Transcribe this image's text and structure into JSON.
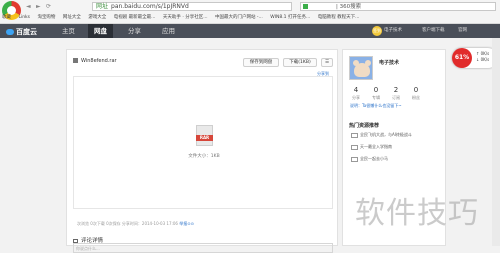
{
  "browser": {
    "url_prefix": "网址",
    "url": "pan.baidu.com/s/1pJRNVd",
    "search_text": "| 360搜索",
    "nav_back": "◄",
    "nav_forward": "►",
    "nav_refresh": "⟳",
    "bookmarks": [
      "收藏",
      "Links",
      "淘宝购物",
      "网址大全",
      "游戏大全",
      "电视剧 最新最全最...",
      "天天助手 · 分享社区...",
      "中国最大的门户网站 -...",
      "WIN8.1 打开任务...",
      "电脑教程 教程天下..."
    ]
  },
  "header": {
    "logo": "百度云",
    "tabs": [
      "主页",
      "网盘",
      "分享",
      "应用"
    ],
    "active_tab": "网盘",
    "user_name": "电子技术",
    "links": [
      "客户端下载",
      "官网"
    ],
    "sign_badge": "签到"
  },
  "speed_widget": {
    "percent": "61%",
    "line1": "↑ 0K/s",
    "line2": "↓ 0K/s"
  },
  "file": {
    "name": "Win8efend.rar",
    "save_label": "保存到网盘",
    "download_label": "下载(1KB)",
    "report_label": "举报",
    "share_line": "分享到",
    "type_label": "RAR",
    "size_text": "文件大小：1KB",
    "meta": "次浏览   0次下载   0次保存   分享时间：2014-10-03 17:06",
    "meta_link": "举报⊙⊙",
    "comment_title": "评论详情",
    "comment_placeholder": "你说点什么..."
  },
  "sidebar": {
    "user_name": "电子技术",
    "stats": [
      {
        "n": "4",
        "l": "分享"
      },
      {
        "n": "0",
        "l": "专辑"
      },
      {
        "n": "2",
        "l": "订阅"
      },
      {
        "n": "0",
        "l": "粉丝"
      }
    ],
    "message": "说明：Ta很懒什么也没留下~",
    "hot_title": "热门资源推荐",
    "hot_items": [
      "全民飞机大战，与AI终极战斗",
      "天一最全入学指南",
      "全民一起去小马"
    ]
  },
  "watermark": "软件技巧"
}
